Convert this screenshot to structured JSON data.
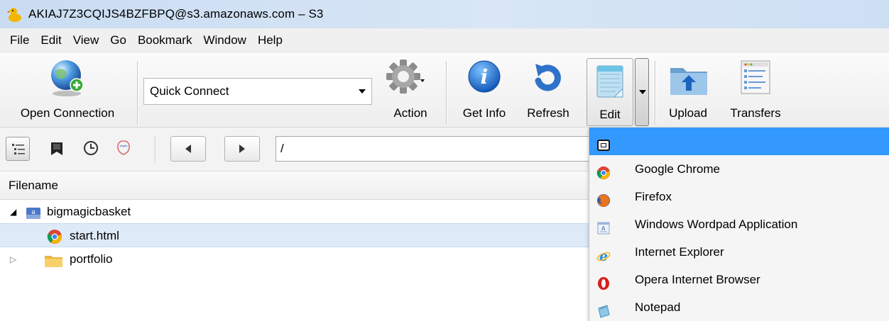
{
  "window": {
    "title": "AKIAJ7Z3CQIJS4BZFBPQ@s3.amazonaws.com – S3"
  },
  "menubar": {
    "items": [
      "File",
      "Edit",
      "View",
      "Go",
      "Bookmark",
      "Window",
      "Help"
    ]
  },
  "toolbar": {
    "open_connection": "Open Connection",
    "quick_connect": "Quick Connect",
    "action": "Action",
    "get_info": "Get Info",
    "refresh": "Refresh",
    "edit": "Edit",
    "upload": "Upload",
    "transfers": "Transfers"
  },
  "path": {
    "value": "/"
  },
  "filelist": {
    "header": "Filename",
    "rows": [
      {
        "name": "bigmagicbasket",
        "icon": "bucket-icon",
        "expanded": true
      },
      {
        "name": "start.html",
        "icon": "chrome-file-icon",
        "selected": true
      },
      {
        "name": "portfolio",
        "icon": "folder-icon",
        "expanded": false
      }
    ]
  },
  "edit_menu": {
    "items": [
      {
        "label": "",
        "icon": "blank-editor-icon",
        "highlighted": true
      },
      {
        "label": "Google Chrome",
        "icon": "chrome-icon"
      },
      {
        "label": "Firefox",
        "icon": "firefox-icon"
      },
      {
        "label": "Windows Wordpad Application",
        "icon": "wordpad-icon"
      },
      {
        "label": "Internet Explorer",
        "icon": "ie-icon"
      },
      {
        "label": "Opera Internet Browser",
        "icon": "opera-icon"
      },
      {
        "label": "Notepad",
        "icon": "notepad-icon"
      }
    ]
  },
  "colors": {
    "highlight": "#3399ff",
    "selected_row": "#dfeaf8",
    "title_bar": "#cddff3"
  }
}
